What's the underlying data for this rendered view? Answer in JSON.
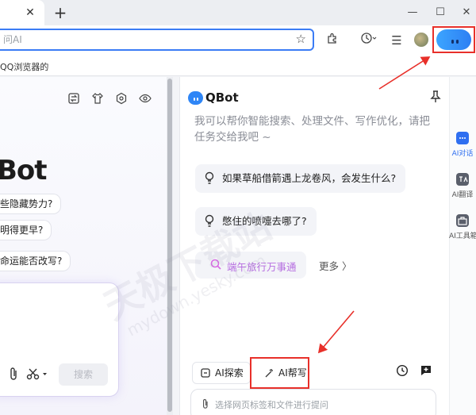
{
  "browser": {
    "tab_close_glyph": "✕",
    "new_tab_glyph": "+",
    "window_controls": [
      "—",
      "☐",
      "✕"
    ],
    "address_placeholder": "问AI",
    "bookmark_text": "QQ浏览器的"
  },
  "left_page": {
    "brand": "Bot",
    "chips": [
      "些隐藏势力?",
      "明得更早?",
      "命运能否改写?"
    ],
    "search_label": "搜索"
  },
  "qbot_panel": {
    "title": "QBot",
    "intro": "我可以帮你智能搜索、处理文件、写作优化，请把任务交给我吧 ~",
    "suggestions": [
      "如果草船借箭遇上龙卷风，会发生什么?",
      "憋住的喷嚏去哪了?"
    ],
    "promo": "端午旅行万事通",
    "more": "更多 〉",
    "modes": [
      "AI探索",
      "AI帮写"
    ],
    "chat_placeholder": "选择网页标签和文件进行提问"
  },
  "right_sidebar": {
    "items": [
      {
        "label": "AI对话",
        "color": "#2f6ff0"
      },
      {
        "label": "AI翻译",
        "color": "#5a5f6b"
      },
      {
        "label": "AI工具箱",
        "color": "#5a5f6b"
      }
    ]
  },
  "watermark": {
    "main": "天极下载站",
    "sub": "mydown.yesky.com"
  },
  "colors": {
    "accent": "#3b7cf5",
    "annotation": "#e8302a",
    "promo": "#b66ee0"
  }
}
